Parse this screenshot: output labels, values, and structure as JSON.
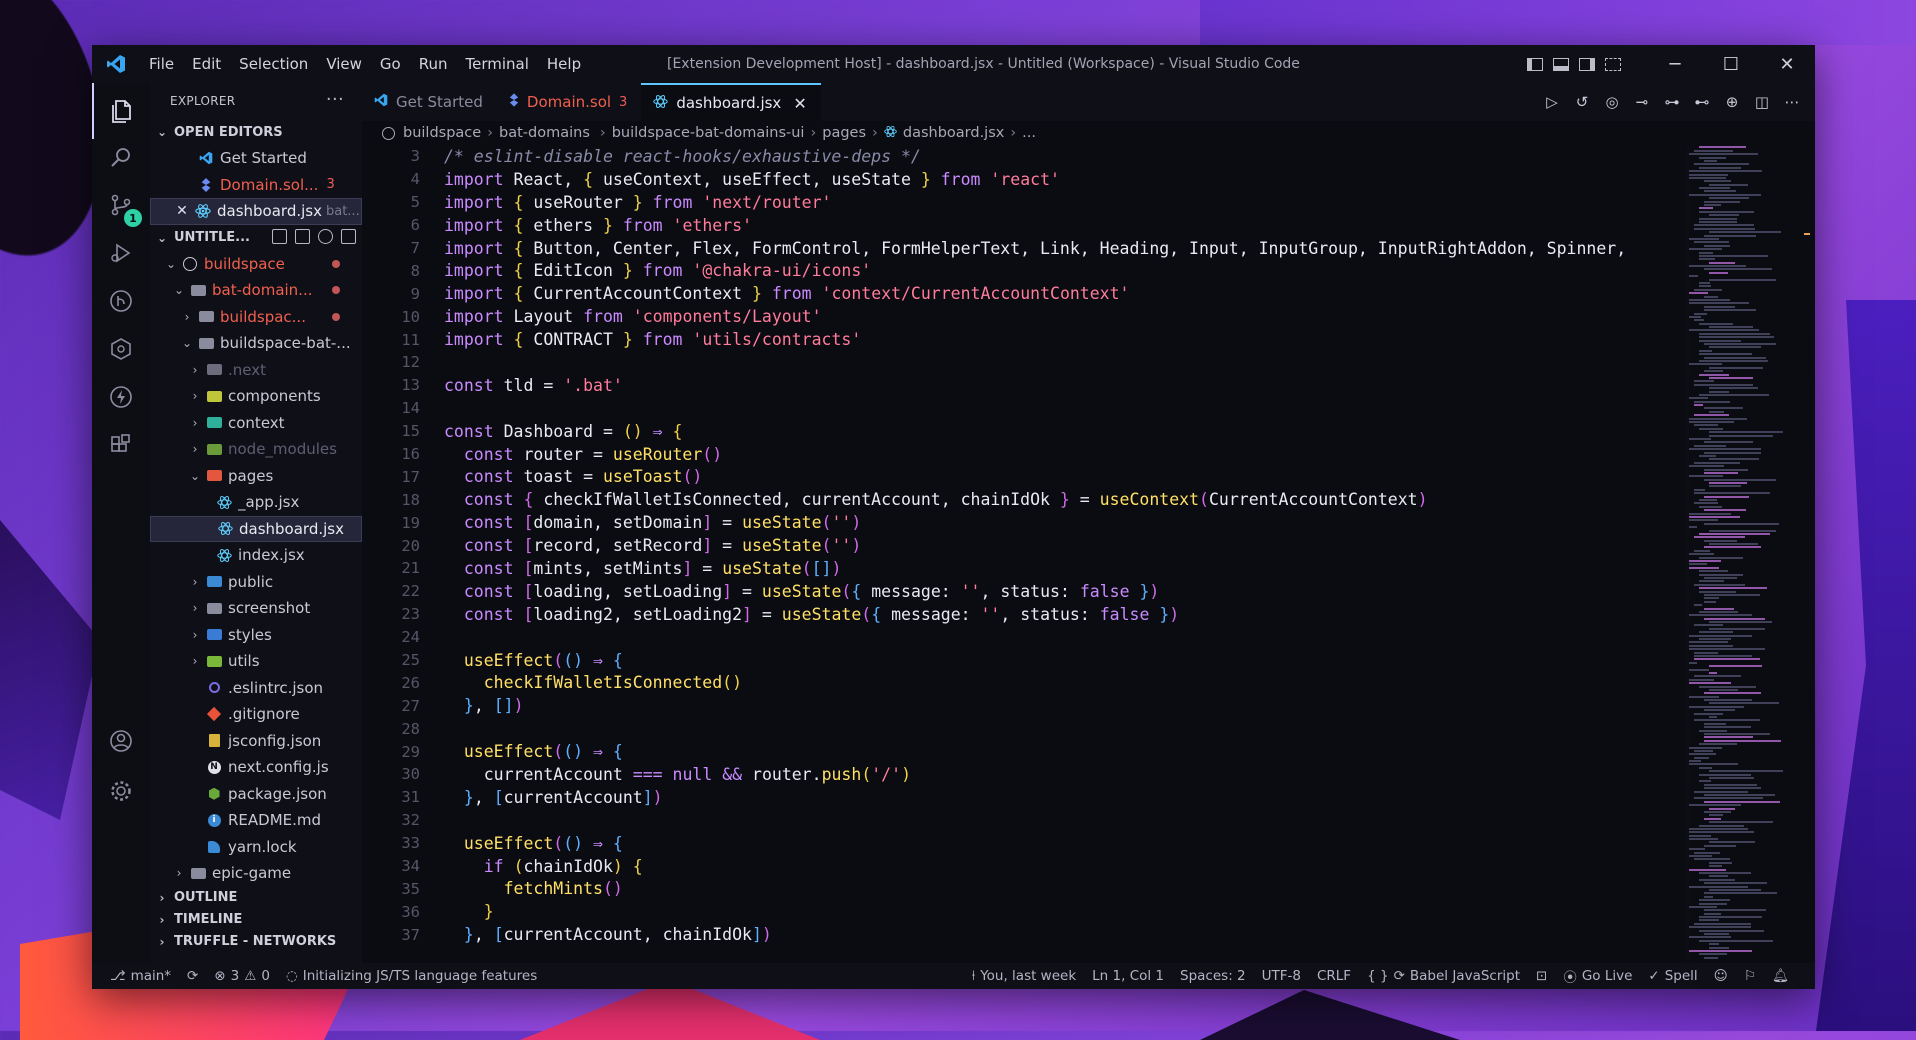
{
  "window": {
    "title": "[Extension Development Host] - dashboard.jsx - Untitled (Workspace) - Visual Studio Code",
    "menu": [
      "File",
      "Edit",
      "Selection",
      "View",
      "Go",
      "Run",
      "Terminal",
      "Help"
    ]
  },
  "sidebar": {
    "header": "EXPLORER",
    "more": "···",
    "open_editors_title": "OPEN EDITORS",
    "open_editors": [
      {
        "label": "Get Started",
        "icon": "vscode-icon"
      },
      {
        "label": "Domain.sol...",
        "icon": "solidity-icon",
        "errors": "3"
      },
      {
        "label": "dashboard.jsx",
        "icon": "react-icon",
        "sub": "bat..."
      }
    ],
    "workspace_title": "UNTITLE...",
    "tree": [
      {
        "label": "buildspace",
        "icon": "circle-icon"
      },
      {
        "label": "bat-domain...",
        "icon": "folder-icon"
      },
      {
        "label": "buildspac...",
        "icon": "folder-icon"
      },
      {
        "label": "buildspace-bat-...",
        "icon": "folder-icon"
      },
      {
        "label": ".next",
        "icon": "folder-next-icon"
      },
      {
        "label": "components",
        "icon": "folder-components-icon"
      },
      {
        "label": "context",
        "icon": "folder-context-icon"
      },
      {
        "label": "node_modules",
        "icon": "folder-node-icon"
      },
      {
        "label": "pages",
        "icon": "folder-pages-icon"
      },
      {
        "label": "_app.jsx",
        "icon": "react-icon"
      },
      {
        "label": "dashboard.jsx",
        "icon": "react-icon"
      },
      {
        "label": "index.jsx",
        "icon": "react-icon"
      },
      {
        "label": "public",
        "icon": "folder-public-icon"
      },
      {
        "label": "screenshot",
        "icon": "folder-icon"
      },
      {
        "label": "styles",
        "icon": "folder-styles-icon"
      },
      {
        "label": "utils",
        "icon": "folder-utils-icon"
      },
      {
        "label": ".eslintrc.json",
        "icon": "eslint-icon"
      },
      {
        "label": ".gitignore",
        "icon": "git-icon"
      },
      {
        "label": "jsconfig.json",
        "icon": "json-icon"
      },
      {
        "label": "next.config.js",
        "icon": "next-icon"
      },
      {
        "label": "package.json",
        "icon": "node-icon"
      },
      {
        "label": "README.md",
        "icon": "info-icon"
      },
      {
        "label": "yarn.lock",
        "icon": "yarn-icon"
      },
      {
        "label": "epic-game",
        "icon": "folder-icon"
      }
    ],
    "outline": "OUTLINE",
    "timeline": "TIMELINE",
    "truffle": "TRUFFLE - NETWORKS"
  },
  "tabs": [
    {
      "label": "Get Started",
      "icon": "vscode-icon"
    },
    {
      "label": "Domain.sol",
      "icon": "solidity-icon",
      "errors": "3"
    },
    {
      "label": "dashboard.jsx",
      "icon": "react-icon"
    }
  ],
  "breadcrumbs": [
    "buildspace",
    "bat-domains",
    "buildspace-bat-domains-ui",
    "pages",
    "dashboard.jsx",
    "..."
  ],
  "editor": {
    "line_numbers": [
      "3",
      "4",
      "5",
      "6",
      "7",
      "8",
      "9",
      "10",
      "11",
      "12",
      "13",
      "14",
      "15",
      "16",
      "17",
      "18",
      "19",
      "20",
      "21",
      "22",
      "23",
      "24",
      "25",
      "26",
      "27",
      "28",
      "29",
      "30",
      "31",
      "32",
      "33",
      "34",
      "35",
      "36",
      "37"
    ]
  },
  "statusbar": {
    "branch": "main*",
    "errors": "3",
    "warnings": "0",
    "task": "Initializing JS/TS language features",
    "blame": "You, last week",
    "position": "Ln 1, Col 1",
    "spaces": "Spaces: 2",
    "encoding": "UTF-8",
    "eol": "CRLF",
    "language": "Babel JavaScript",
    "golive": "Go Live",
    "spell": "Spell"
  },
  "colors": {
    "accent": "#5ec6ff",
    "error": "#ef5b5b",
    "badge": "#2dd1a5"
  }
}
